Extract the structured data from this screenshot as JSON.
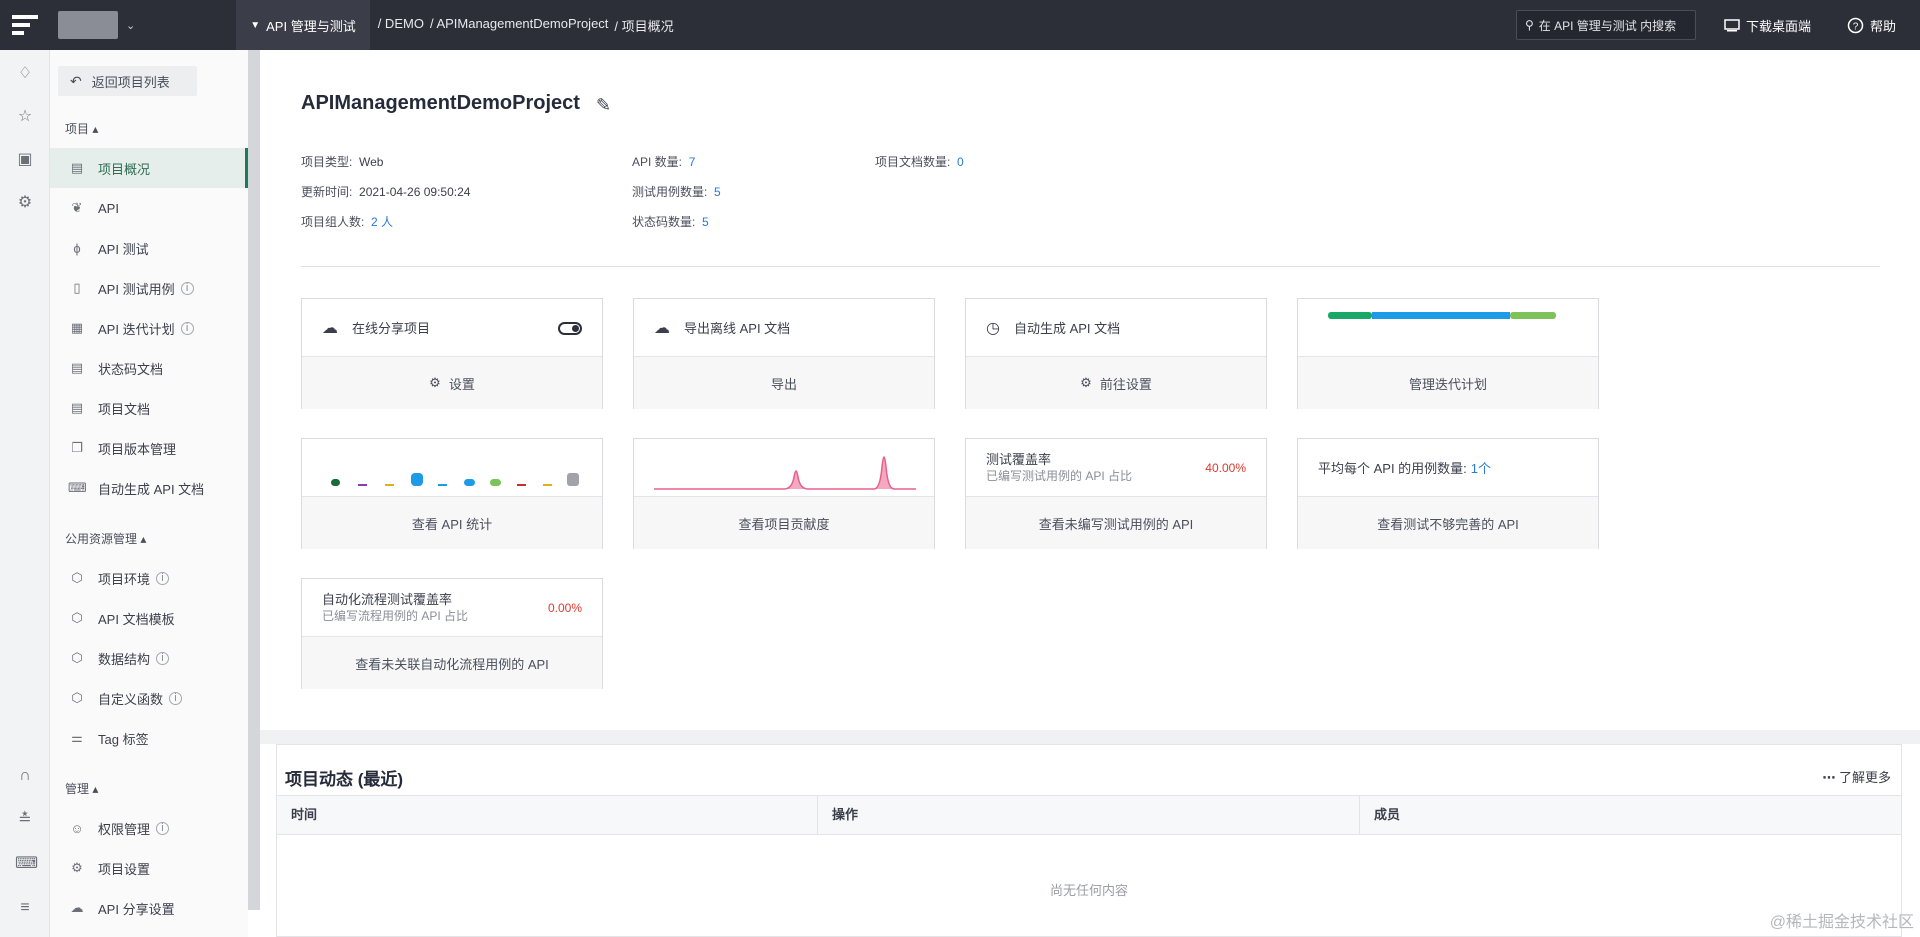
{
  "topbar": {
    "module_label": "API 管理与测试",
    "breadcrumbs": [
      "/ DEMO",
      "/ APIManagementDemoProject",
      "/ 项目概况"
    ],
    "search_placeholder": "在 API 管理与测试 内搜索",
    "download_label": "下载桌面端",
    "help_label": "帮助"
  },
  "sidebar": {
    "back_label": "返回项目列表",
    "group_project": "项目",
    "group_public": "公用资源管理",
    "group_admin": "管理",
    "items": [
      {
        "label": "项目概况",
        "icon": "document-icon"
      },
      {
        "label": "API",
        "icon": "link-icon"
      },
      {
        "label": "API 测试",
        "icon": "lightning-icon"
      },
      {
        "label": "API 测试用例",
        "icon": "clipboard-icon"
      },
      {
        "label": "API 迭代计划",
        "icon": "calendar-icon"
      },
      {
        "label": "状态码文档",
        "icon": "code-doc-icon"
      },
      {
        "label": "项目文档",
        "icon": "doc-list-icon"
      },
      {
        "label": "项目版本管理",
        "icon": "versions-icon"
      },
      {
        "label": "自动生成 API 文档",
        "icon": "robot-icon"
      },
      {
        "label": "项目环境",
        "icon": "cube-icon"
      },
      {
        "label": "API 文档模板",
        "icon": "cube-icon"
      },
      {
        "label": "数据结构",
        "icon": "cube-icon"
      },
      {
        "label": "自定义函数",
        "icon": "cube-icon"
      },
      {
        "label": "Tag 标签",
        "icon": "tag-icon"
      },
      {
        "label": "权限管理",
        "icon": "user-permission-icon"
      },
      {
        "label": "项目设置",
        "icon": "gear-icon"
      },
      {
        "label": "API 分享设置",
        "icon": "cloud-icon"
      }
    ]
  },
  "project": {
    "name": "APIManagementDemoProject",
    "type_label": "项目类型:",
    "type_value": "Web",
    "updated_label": "更新时间:",
    "updated_value": "2021-04-26 09:50:24",
    "members_label": "项目组人数:",
    "members_value": "2 人",
    "api_count_label": "API 数量:",
    "api_count_value": "7",
    "test_case_label": "测试用例数量:",
    "test_case_value": "5",
    "status_code_label": "状态码数量:",
    "status_code_value": "5",
    "doc_count_label": "项目文档数量:",
    "doc_count_value": "0"
  },
  "cards": {
    "share_title": "在线分享项目",
    "share_action": "设置",
    "export_title": "导出离线 API 文档",
    "export_action": "导出",
    "autogen_title": "自动生成 API 文档",
    "autogen_action": "前往设置",
    "iteration_action": "管理迭代计划",
    "stats_action": "查看 API 统计",
    "contrib_action": "查看项目贡献度",
    "coverage_title": "测试覆盖率",
    "coverage_sub": "已编写测试用例的 API 占比",
    "coverage_pct": "40.00%",
    "coverage_action": "查看未编写测试用例的 API",
    "avg_label": "平均每个 API 的用例数量:",
    "avg_value": "1个",
    "avg_action": "查看测试不够完善的 API",
    "flow_title": "自动化流程测试覆盖率",
    "flow_sub": "已编写流程用例的 API 占比",
    "flow_pct": "0.00%",
    "flow_action": "查看未关联自动化流程用例的 API"
  },
  "activity": {
    "title": "项目动态 (最近)",
    "more_label": "了解更多",
    "columns": [
      "时间",
      "操作",
      "成员"
    ],
    "empty_text": "尚无任何内容"
  },
  "watermark": "@稀土掘金技术社区",
  "colors": {
    "accent": "#1f7a5a",
    "link": "#2a7bd1",
    "danger": "#e0392e",
    "topbar": "#2c2f38"
  }
}
